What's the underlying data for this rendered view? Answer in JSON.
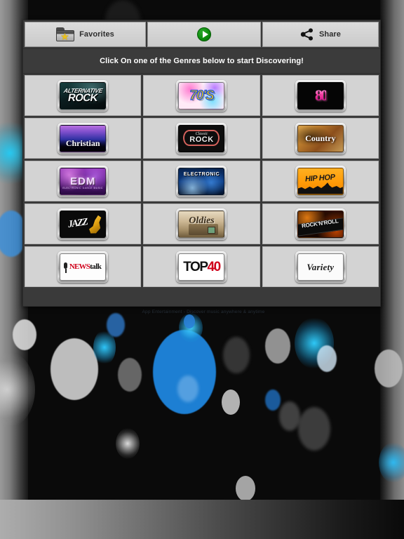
{
  "toolbar": {
    "favorites_label": "Favorites",
    "favorites_icon": "folder-star-icon",
    "play_icon": "play-circle-icon",
    "share_label": "Share",
    "share_icon": "share-nodes-icon"
  },
  "banner": {
    "text": "Click On one of the Genres below to start Discovering!"
  },
  "background": {
    "caption": "App Entertainment - Discover music anywhere & anytime"
  },
  "colors": {
    "panel_bg": "#3a3a3a",
    "cell_bg": "#d3d3d3",
    "toolbar_btn": "#d6d6d6",
    "banner_text": "#ffffff",
    "play_green": "#0b8a0b",
    "accent_blue": "#1e7fd4"
  },
  "grid": {
    "rows": [
      [
        {
          "id": "alternative-rock",
          "name": "Alternative Rock",
          "line1": "ALTERNATIVE",
          "line2": "ROCK"
        },
        {
          "id": "seventies",
          "name": "70's",
          "label": "70'S"
        },
        {
          "id": "eighties",
          "name": "80's",
          "label": "80"
        }
      ],
      [
        {
          "id": "christian",
          "name": "Christian",
          "label": "Christian"
        },
        {
          "id": "classic-rock",
          "name": "Classic Rock",
          "script": "Classic",
          "label": "ROCK"
        },
        {
          "id": "country",
          "name": "Country",
          "label": "Country"
        }
      ],
      [
        {
          "id": "edm",
          "name": "EDM",
          "label": "EDM",
          "sub": "ELECTRONIC DANCE MUSIC"
        },
        {
          "id": "electronic",
          "name": "Electronic",
          "label": "ELECTRONIC"
        },
        {
          "id": "hip-hop",
          "name": "Hip Hop",
          "label": "HIP HOP"
        }
      ],
      [
        {
          "id": "jazz",
          "name": "Jazz",
          "label": "JAZZ"
        },
        {
          "id": "oldies",
          "name": "Oldies",
          "label": "Oldies"
        },
        {
          "id": "rock-n-roll",
          "name": "Rock N Roll",
          "label": "ROCK'N'ROLL"
        }
      ],
      [
        {
          "id": "news-talk",
          "name": "News Talk",
          "part1": "NEWS",
          "part2": "talk"
        },
        {
          "id": "top-40",
          "name": "Top 40",
          "part1": "TOP",
          "part2": "40"
        },
        {
          "id": "variety",
          "name": "Variety",
          "label": "Variety"
        }
      ]
    ]
  }
}
